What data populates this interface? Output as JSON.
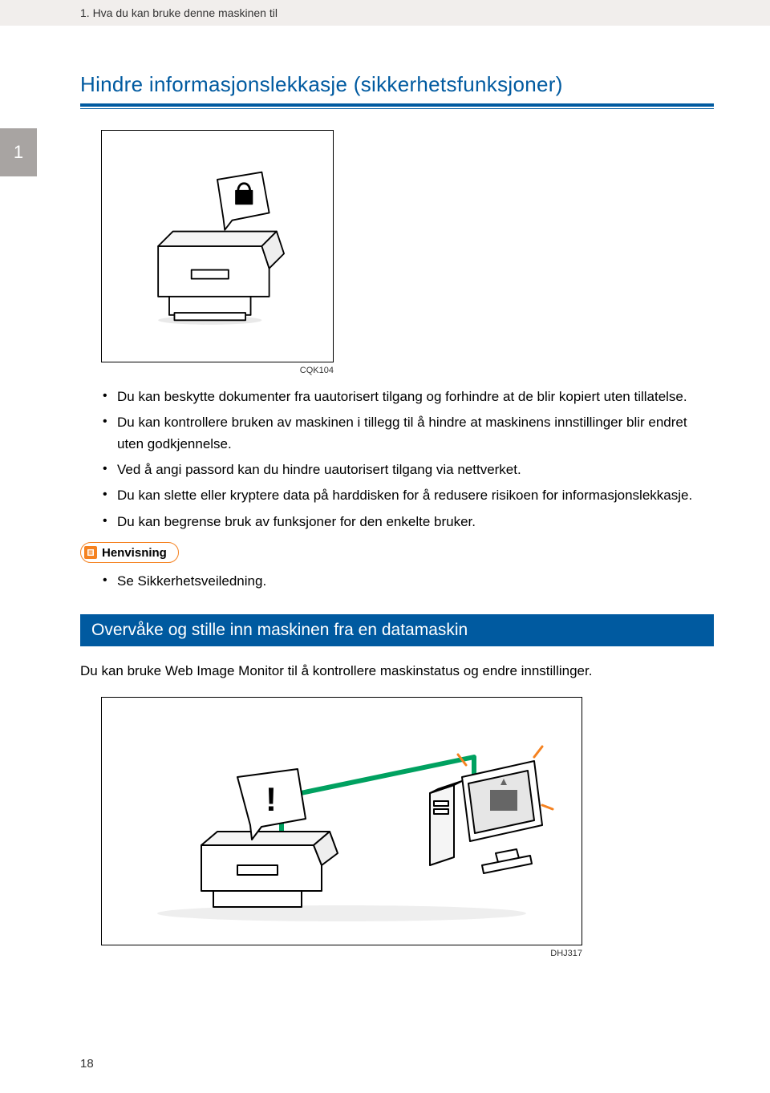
{
  "header": {
    "chapter_title": "1. Hva du kan bruke denne maskinen til"
  },
  "tab": {
    "number": "1"
  },
  "section1": {
    "title": "Hindre informasjonslekkasje (sikkerhetsfunksjoner)",
    "figure_caption": "CQK104",
    "bullets": [
      "Du kan beskytte dokumenter fra uautorisert tilgang og forhindre at de blir kopiert uten tillatelse.",
      "Du kan kontrollere bruken av maskinen i tillegg til å hindre at maskinens innstillinger blir endret uten godkjennelse.",
      "Ved å angi passord kan du hindre uautorisert tilgang via nettverket.",
      "Du kan slette eller kryptere data på harddisken for å redusere risikoen for informasjonslekkasje.",
      "Du kan begrense bruk av funksjoner for den enkelte bruker."
    ],
    "reference_label": "Henvisning",
    "reference_items": [
      "Se Sikkerhetsveiledning."
    ]
  },
  "section2": {
    "title": "Overvåke og stille inn maskinen fra en datamaskin",
    "paragraph": "Du kan bruke Web Image Monitor til å kontrollere maskinstatus og endre innstillinger.",
    "figure_caption": "DHJ317"
  },
  "page_number": "18"
}
